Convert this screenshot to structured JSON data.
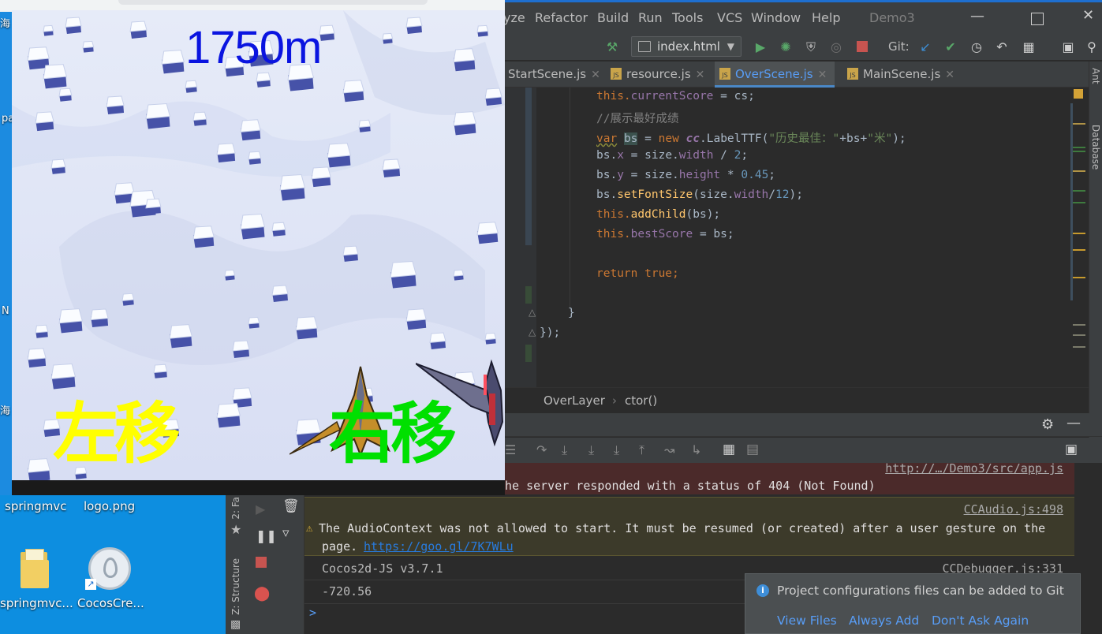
{
  "ide": {
    "menu": [
      "yze",
      "Refactor",
      "Build",
      "Run",
      "Tools",
      "VCS",
      "Window",
      "Help"
    ],
    "project": "Demo3",
    "run_config": "index.html",
    "git_label": "Git:",
    "tabs": [
      {
        "label": "StartScene.js",
        "active": false
      },
      {
        "label": "resource.js",
        "active": false
      },
      {
        "label": "OverScene.js",
        "active": true
      },
      {
        "label": "MainScene.js",
        "active": false
      }
    ],
    "right_tools": [
      "Ant",
      "Database"
    ],
    "breadcrumb": [
      "OverLayer",
      "ctor()"
    ],
    "left_tools": [
      "2: Fa",
      "Z: Structure"
    ]
  },
  "code": {
    "l1_this": "this.",
    "l1_prop": "currentScore",
    "l1_rest": " = cs;",
    "l2": "//展示最好成绩",
    "l3_var": "var",
    "l3_bs": "bs",
    "l3_eq": " = ",
    "l3_new": "new",
    "l3_cc": "cc",
    "l3_label": ".LabelTTF(",
    "l3_str": "\"历史最佳：\"",
    "l3_plus": "+bs+",
    "l3_str2": "\"米\"",
    "l3_end": ");",
    "l4_a": "bs.",
    "l4_x": "x",
    "l4_b": " = size.",
    "l4_w": "width",
    "l4_c": " / ",
    "l4_n": "2",
    "l4_d": ";",
    "l5_a": "bs.",
    "l5_y": "y",
    "l5_b": " = size.",
    "l5_h": "height",
    "l5_c": " * ",
    "l5_n": "0.45",
    "l5_d": ";",
    "l6_a": "bs.",
    "l6_fn": "setFontSize",
    "l6_b": "(size.",
    "l6_w": "width",
    "l6_c": "/",
    "l6_n": "12",
    "l6_d": ");",
    "l7_this": "this.",
    "l7_fn": "addChild",
    "l7_rest": "(bs);",
    "l8_this": "this.",
    "l8_prop": "bestScore",
    "l8_rest": " = bs;",
    "l9_kw": "return",
    "l9_true": " true",
    "l9_end": ";",
    "l10": "}",
    "l11": "});"
  },
  "console": {
    "top_src": "http://…/Demo3/src/app.js",
    "error_text": "he server responded with a status of 404 (Not Found)",
    "warn_src": "CCAudio.js:498",
    "warn_text": "The AudioContext was not allowed to start. It must be resumed (or created) after a user gesture on the",
    "warn_text2": "page. ",
    "warn_link": "https://goo.gl/7K7WLu",
    "info_text": "Cocos2d-JS v3.7.1",
    "info_src": "CCDebugger.js:331",
    "value_text": "-720.56",
    "prompt": ">"
  },
  "notification": {
    "message": "Project configurations files can be added to Git",
    "actions": [
      "View Files",
      "Always Add",
      "Don't Ask Again"
    ]
  },
  "game": {
    "distance": "1750m",
    "left_button": "左移",
    "right_button": "右移"
  },
  "desktop": {
    "icons_top": [
      "springmvc",
      "logo.png"
    ],
    "icons_bottom": [
      "springmvc...",
      "CocosCre..."
    ],
    "edge_labels": [
      "海",
      "pa",
      "N",
      "海"
    ]
  },
  "colors": {
    "distance": "#0a14e0",
    "left_button": "#ffff00",
    "right_button": "#00e000",
    "accent": "#589df6"
  }
}
